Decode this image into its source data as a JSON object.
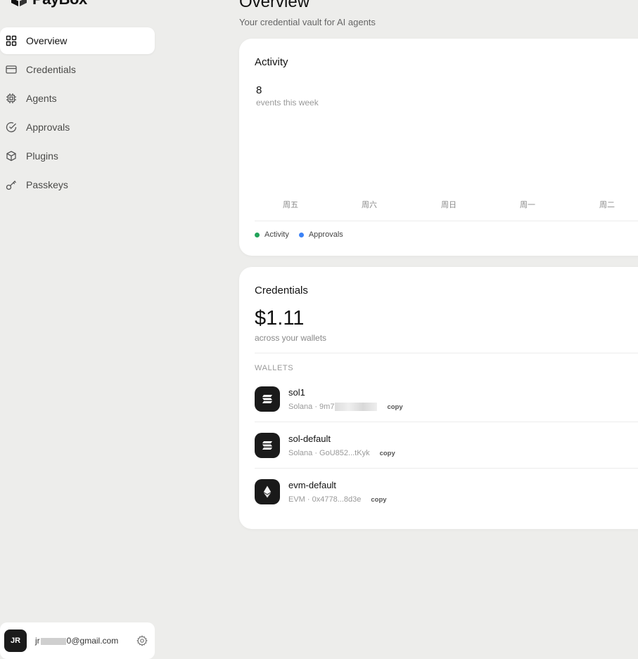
{
  "app": {
    "name": "PayBox"
  },
  "sidebar": {
    "items": [
      {
        "label": "Overview",
        "icon": "grid-icon",
        "active": true
      },
      {
        "label": "Credentials",
        "icon": "card-icon",
        "active": false
      },
      {
        "label": "Agents",
        "icon": "cpu-icon",
        "active": false
      },
      {
        "label": "Approvals",
        "icon": "check-circle-icon",
        "active": false
      },
      {
        "label": "Plugins",
        "icon": "box-icon",
        "active": false
      },
      {
        "label": "Passkeys",
        "icon": "key-icon",
        "active": false
      }
    ]
  },
  "user": {
    "initials": "JR",
    "email_prefix": "jr",
    "email_suffix": "0@gmail.com"
  },
  "header": {
    "title": "Overview",
    "subtitle": "Your credential vault for AI agents"
  },
  "activity": {
    "title": "Activity",
    "count": "8",
    "count_label": "events this week",
    "days": [
      "周五",
      "周六",
      "周日",
      "周一",
      "周二"
    ],
    "legend": [
      {
        "label": "Activity",
        "color": "#22a35a"
      },
      {
        "label": "Approvals",
        "color": "#3b82f6"
      }
    ]
  },
  "credentials": {
    "title": "Credentials",
    "total": "$1.11",
    "total_label": "across your wallets",
    "wallets_label": "WALLETS",
    "wallets": [
      {
        "name": "sol1",
        "chain": "Solana",
        "address": "9m7",
        "address_blurred": true,
        "icon": "solana-icon",
        "copy": "copy"
      },
      {
        "name": "sol-default",
        "chain": "Solana",
        "address": "GoU852...tKyk",
        "address_blurred": false,
        "icon": "solana-icon",
        "copy": "copy"
      },
      {
        "name": "evm-default",
        "chain": "EVM",
        "address": "0x4778...8d3e",
        "address_blurred": false,
        "icon": "ethereum-icon",
        "copy": "copy"
      }
    ]
  }
}
